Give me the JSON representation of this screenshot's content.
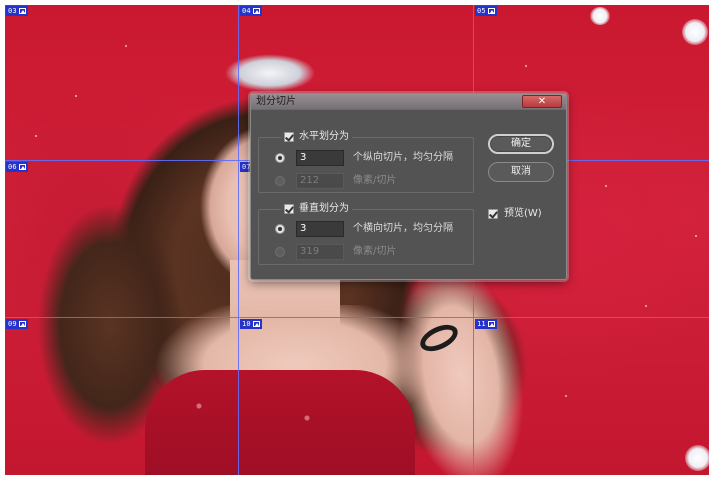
{
  "slices": [
    {
      "id": "03"
    },
    {
      "id": "04"
    },
    {
      "id": "05"
    },
    {
      "id": "06"
    },
    {
      "id": "07"
    },
    {
      "id": "09"
    },
    {
      "id": "10"
    },
    {
      "id": "11"
    }
  ],
  "dialog": {
    "title": "划分切片",
    "close_label": "✕",
    "horizontal": {
      "checkbox_label": "水平划分为",
      "checked": true,
      "option1_value": "3",
      "option1_label": "个纵向切片，均匀分隔",
      "option2_value": "212",
      "option2_label": "像素/切片"
    },
    "vertical": {
      "checkbox_label": "垂直划分为",
      "checked": true,
      "option1_value": "3",
      "option1_label": "个横向切片，均匀分隔",
      "option2_value": "319",
      "option2_label": "像素/切片"
    },
    "ok_label": "确定",
    "cancel_label": "取消",
    "preview_label": "预览(W)",
    "preview_checked": true
  },
  "colors": {
    "slice_line": "#606eff",
    "slice_tag": "#2633c9",
    "dialog_bg": "#535353"
  },
  "icons": {
    "slice_badge": "image-icon",
    "close": "close-icon",
    "checkbox": "checkmark-icon"
  }
}
